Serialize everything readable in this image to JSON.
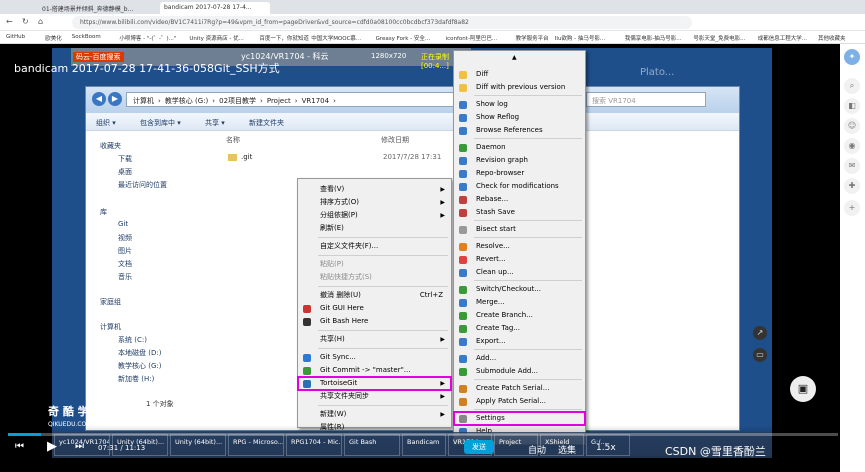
{
  "browser": {
    "tabs": [
      {
        "label": "01-搭建场景并倾斜_奔德静模_b..."
      },
      {
        "label": "bandicam 2017-07-28 17-4..."
      }
    ],
    "url": "https://www.bilibili.com/video/BV1C7411i7Rg?p=49&vpm_id_from=pageDriver&vd_source=cdfd0a08100cc0bcdbcf373dafdf8a82",
    "bookmarks": [
      "GitHub",
      "欧美化",
      "SockBoom",
      "小呗博客 - \"-(゜-゜)...\"",
      "Unity 资源商店 - 优...",
      "百度一下，你就知道",
      "中国大学MOOC慕...",
      "Greasy Fork - 安全...",
      "iconfont-阿里巴巴...",
      "教学服务平台",
      "Ilu欲购 - 抽马号影...",
      "我偶享电影-抽马号影...",
      "号影天堂_免费电影...",
      "成都信息工程大学...",
      "其他收藏夹"
    ]
  },
  "video": {
    "title": "bandicam 2017-07-28 17-41-36-058Git_SSH方式",
    "current_time": "07:31",
    "duration": "11:13",
    "auto_label": "自动",
    "select_label": "选集",
    "speed_label": "1.5x",
    "progress_fraction": 0.04
  },
  "recording": {
    "resolution": "1280x720",
    "status": "正在录制 [00:4...]",
    "window_title": "yc1024/VR1704 - 科云",
    "left_tabs": [
      "码云-百度搜索"
    ],
    "watermark_bg": "Plato..."
  },
  "explorer": {
    "breadcrumb": [
      "计算机",
      "教学核心 (G:)",
      "02项目教学",
      "Project",
      "VR1704"
    ],
    "search_placeholder": "搜索 VR1704",
    "commands": [
      "组织 ▾",
      "包含到库中 ▾",
      "共享 ▾",
      "新建文件夹"
    ],
    "columns": {
      "name": "名称",
      "date": "修改日期"
    },
    "files": [
      {
        "name": ".git",
        "date": "2017/7/28 17:31"
      }
    ],
    "nav": {
      "favorites": "收藏夹",
      "fav_items": [
        "下载",
        "桌面",
        "最近访问的位置"
      ],
      "library": "库",
      "lib_items": [
        "Git",
        "视频",
        "图片",
        "文档",
        "音乐"
      ],
      "homegroup": "家庭组",
      "computer": "计算机",
      "drives": [
        "系统 (C:)",
        "本地磁盘 (D:)",
        "教学核心 (G:)",
        "新加卷 (H:)"
      ]
    },
    "status": "1 个对象"
  },
  "context_menu": {
    "items": [
      {
        "label": "查看(V)",
        "arrow": true,
        "disabled": false
      },
      {
        "label": "排序方式(O)",
        "arrow": true,
        "disabled": false
      },
      {
        "label": "分组依据(P)",
        "arrow": true,
        "disabled": false
      },
      {
        "label": "刷新(E)",
        "arrow": false,
        "disabled": false
      },
      {
        "label": "自定义文件夹(F)...",
        "arrow": false,
        "disabled": false
      },
      {
        "label": "粘贴(P)",
        "arrow": false,
        "disabled": true
      },
      {
        "label": "粘贴快捷方式(S)",
        "arrow": false,
        "disabled": true
      },
      {
        "label": "撤消 删除(U)",
        "shortcut": "Ctrl+Z",
        "disabled": false
      },
      {
        "label": "Git GUI Here",
        "disabled": false
      },
      {
        "label": "Git Bash Here",
        "disabled": false
      },
      {
        "label": "共享(H)",
        "arrow": true,
        "disabled": false
      },
      {
        "label": "Git Sync...",
        "disabled": false
      },
      {
        "label": "Git Commit -> \"master\"...",
        "disabled": false
      },
      {
        "label": "TortoiseGit",
        "arrow": true,
        "disabled": false
      },
      {
        "label": "共享文件夹同步",
        "arrow": true,
        "disabled": false
      },
      {
        "label": "新建(W)",
        "arrow": true,
        "disabled": false
      },
      {
        "label": "属性(R)",
        "disabled": false
      }
    ]
  },
  "tortoise_menu": {
    "items": [
      "Diff",
      "Diff with previous version",
      "Show log",
      "Show Reflog",
      "Browse References",
      "Daemon",
      "Revision graph",
      "Repo-browser",
      "Check for modifications",
      "Rebase...",
      "Stash Save",
      "Bisect start",
      "Resolve...",
      "Revert...",
      "Clean up...",
      "Switch/Checkout...",
      "Merge...",
      "Create Branch...",
      "Create Tag...",
      "Export...",
      "Add...",
      "Submodule Add...",
      "Create Patch Serial...",
      "Apply Patch Serial...",
      "Settings",
      "Help"
    ]
  },
  "taskbar": {
    "items": [
      "yc1024/VR1704...",
      "Unity (64bit)...",
      "Unity (64bit)...",
      "RPG - Microso...",
      "RPG1704 - Mic...",
      "Git Bash",
      "Bandicam",
      "VR1704",
      "Project",
      "XShield",
      "G:/..."
    ]
  },
  "overlay": {
    "logo": "奇 酷 学 院",
    "logo_sub": "QIKUEDU.COM",
    "csdn": "CSDN @雪里香酚兰",
    "send_label": "发送"
  },
  "colors": {
    "highlight": "#e000e0",
    "progress": "#00a1d6"
  }
}
